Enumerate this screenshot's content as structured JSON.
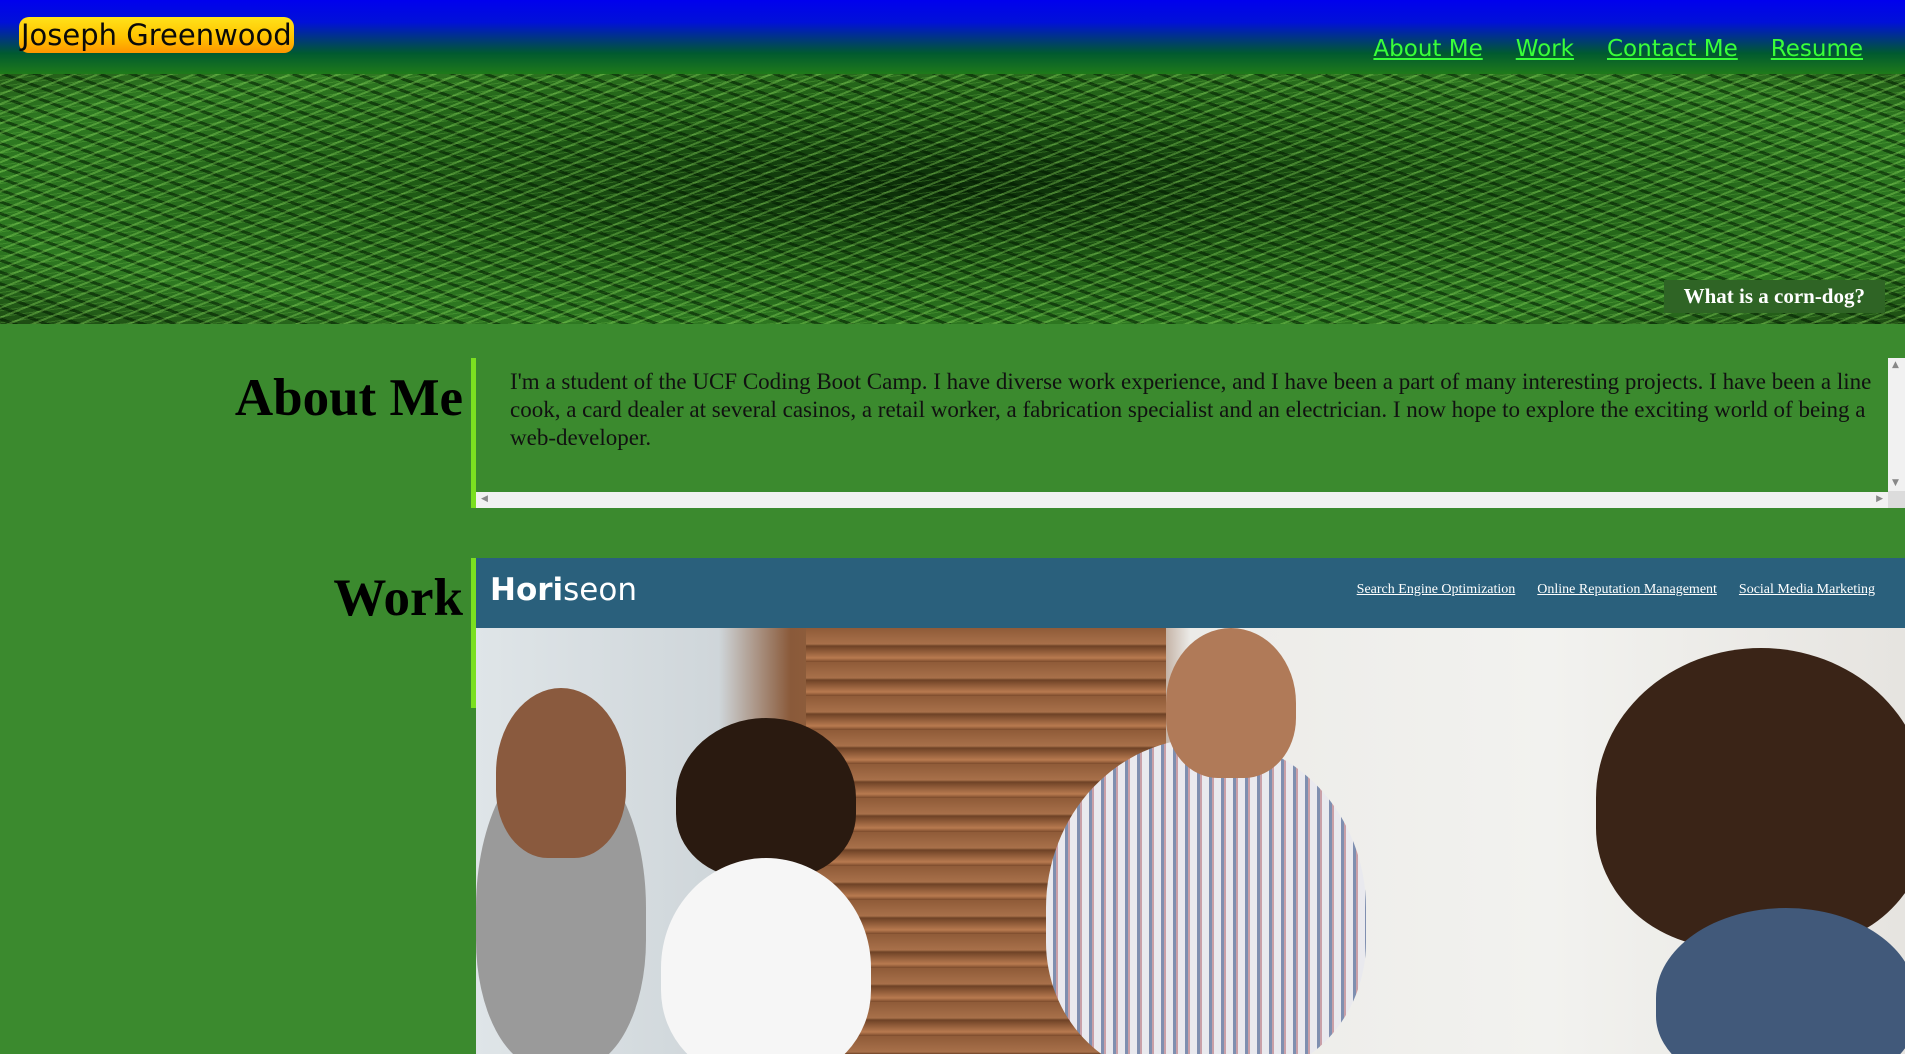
{
  "header": {
    "brand": "Joseph Greenwood",
    "nav": [
      "About Me",
      "Work",
      "Contact Me",
      "Resume"
    ]
  },
  "hero": {
    "caption": "What is a corn-dog?"
  },
  "about": {
    "title": "About Me",
    "text": "I'm a student of the UCF Coding Boot Camp. I have diverse work experience, and I have been a part of many interesting projects. I have been a line cook, a card dealer at several casinos, a retail worker, a fabrication specialist and an electrician. I now hope to explore the exciting world of being a web-developer."
  },
  "work": {
    "title": "Work",
    "preview": {
      "logo_bold": "Hori",
      "logo_light": "seon",
      "nav": [
        "Search Engine Optimization",
        "Online Reputation Management",
        "Social Media Marketing"
      ]
    }
  },
  "colors": {
    "page_bg": "#3b8a2e",
    "nav_link": "#39ff39",
    "accent_bar": "#7be020",
    "preview_header": "#2a607c"
  }
}
